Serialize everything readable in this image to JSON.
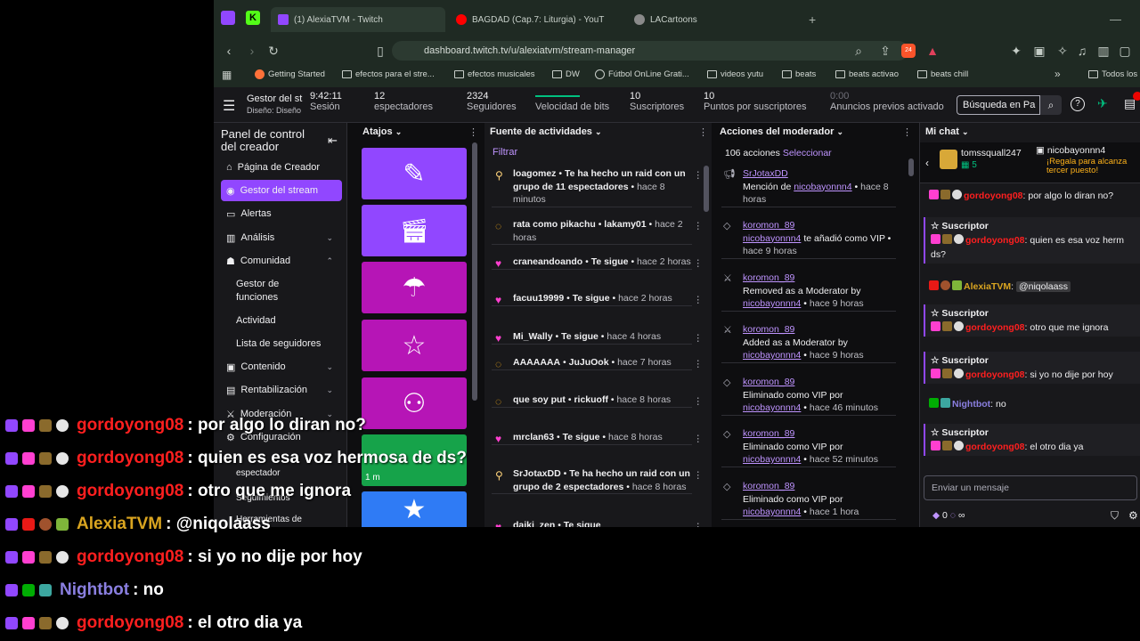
{
  "browser": {
    "tabs": [
      {
        "label": "(1) AlexiaTVM - Twitch",
        "color": "#9147ff"
      },
      {
        "label": "BAGDAD (Cap.7: Liturgia) - YouT",
        "color": "#ff0000"
      },
      {
        "label": "LACartoons",
        "color": "#8a8a8a"
      }
    ],
    "url": "dashboard.twitch.tv/u/alexiatvm/stream-manager",
    "bookmarks": [
      "Getting Started",
      "efectos para el stre...",
      "efectos musicales",
      "DW",
      "Fútbol OnLine Grati...",
      "videos yutu",
      "beats",
      "beats activao",
      "beats chill",
      "Todos los"
    ],
    "badge_count": "24"
  },
  "topbar": {
    "manager_title": "Gestor del st",
    "layout_label": "Diseño: Diseño",
    "session": {
      "value": "9:42:11",
      "label": "Sesión"
    },
    "viewers": {
      "value": "12",
      "label": "espectadores"
    },
    "followers": {
      "value": "2324",
      "label": "Seguidores"
    },
    "bitrate": {
      "label": "Velocidad de bits"
    },
    "subs": {
      "value": "10",
      "label": "Suscriptores"
    },
    "points": {
      "value": "10",
      "label": "Puntos por suscriptores"
    },
    "ads": {
      "value": "0:00",
      "label": "Anuncios previos activado"
    },
    "search_placeholder": "Búsqueda en Pa"
  },
  "sidebar": {
    "title": "Panel de control del creador",
    "items": [
      {
        "label": "Página de Creador",
        "icon": "home-icon"
      },
      {
        "label": "Gestor del stream",
        "icon": "broadcast-icon",
        "active": true
      },
      {
        "label": "Alertas",
        "icon": "alert-icon"
      },
      {
        "label": "Análisis",
        "icon": "chart-icon"
      },
      {
        "label": "Comunidad",
        "icon": "community-icon"
      }
    ],
    "sub_items": [
      "Gestor de funciones",
      "Actividad",
      "Lista de seguidores"
    ],
    "items2": [
      "Contenido",
      "Rentabilización",
      "Moderación",
      "Configuración"
    ],
    "hidden_items": [
      "espectador",
      "Seguimientos",
      "Herramientas de"
    ]
  },
  "atajos": {
    "title": "Atajos",
    "timer": "1 m"
  },
  "feed": {
    "title": "Fuente de actividades",
    "filter": "Filtrar",
    "items": [
      {
        "user": "loagomez",
        "action": "Te ha hecho un raid con un grupo de 11 espectadores",
        "time": "hace 8 minutos",
        "icon": "raid-icon"
      },
      {
        "user": "rata como pikachu",
        "action": "lakamy01",
        "time": "hace 2 horas",
        "icon": "points-icon"
      },
      {
        "user": "craneandoando",
        "action": "Te sigue",
        "time": "hace 2 horas",
        "icon": "heart-icon"
      },
      {
        "user": "facuu19999",
        "action": "Te sigue",
        "time": "hace 2 horas",
        "icon": "heart-icon"
      },
      {
        "user": "Mi_Wally",
        "action": "Te sigue",
        "time": "hace 4 horas",
        "icon": "heart-icon"
      },
      {
        "user": "AAAAAAA",
        "action": "JuJuOok",
        "time": "hace 7 horas",
        "icon": "points-icon"
      },
      {
        "user": "que soy put",
        "action": "rickuoff",
        "time": "hace 8 horas",
        "icon": "points-icon"
      },
      {
        "user": "mrclan63",
        "action": "Te sigue",
        "time": "hace 8 horas",
        "icon": "heart-icon"
      },
      {
        "user": "SrJotaxDD",
        "action": "Te ha hecho un raid con un grupo de 2 espectadores",
        "time": "hace 8 horas",
        "icon": "raid-icon"
      },
      {
        "user": "daiki_zen",
        "action": "Te sigue",
        "time": "",
        "icon": "heart-icon"
      }
    ]
  },
  "mod": {
    "title": "Acciones del moderador",
    "count": "106 acciones",
    "select": "Seleccionar",
    "items": [
      {
        "user": "SrJotaxDD",
        "text": "Mención de",
        "target": "nicobayonnn4",
        "time": "hace 8 horas"
      },
      {
        "user": "koromon_89",
        "text": "te añadió como VIP",
        "target": "nicobayonnn4",
        "time": "hace 9 horas"
      },
      {
        "user": "koromon_89",
        "text": "Removed as a Moderator by",
        "target": "nicobayonnn4",
        "time": "hace 9 horas"
      },
      {
        "user": "koromon_89",
        "text": "Added as a Moderator by",
        "target": "nicobayonnn4",
        "time": "hace 9 horas"
      },
      {
        "user": "koromon_89",
        "text": "Eliminado como VIP por",
        "target": "nicobayonnn4",
        "time": "hace 46 minutos"
      },
      {
        "user": "koromon_89",
        "text": "Eliminado como VIP por",
        "target": "nicobayonnn4",
        "time": "hace 52 minutos"
      },
      {
        "user": "koromon_89",
        "text": "Eliminado como VIP por",
        "target": "nicobayonnn4",
        "time": "hace 1 hora"
      }
    ]
  },
  "chat": {
    "title": "Mi chat",
    "gift_user1": "tomssquall247",
    "gift_count": "5",
    "gift_user2": "nicobayonnn4",
    "gift_msg": "¡Regala para alcanza tercer puesto!",
    "sub_label": "Suscriptor",
    "messages": [
      {
        "user": "gordoyong08",
        "text": ": por algo lo diran no?",
        "sub": false
      },
      {
        "user": "gordoyong08",
        "text": ": quien es esa voz herm ds?",
        "sub": true
      },
      {
        "user": "AlexiaTVM",
        "text": ":",
        "mention": "@niqolaass",
        "sub": false
      },
      {
        "user": "gordoyong08",
        "text": ": otro que me ignora",
        "sub": true
      },
      {
        "user": "gordoyong08",
        "text": ": si yo no dije por hoy",
        "sub": true
      },
      {
        "user": "Nightbot",
        "text": ": no",
        "sub": false
      },
      {
        "user": "gordoyong08",
        "text": ": el otro dia ya",
        "sub": true
      }
    ],
    "input_placeholder": "Enviar un mensaje",
    "points": "0",
    "points2": "∞"
  },
  "overlay": [
    {
      "user": "gordoyong08",
      "text": ": por algo lo diran no?",
      "color": "#ff1f1f"
    },
    {
      "user": "gordoyong08",
      "text": ": quien es esa voz hermosa de ds?",
      "color": "#ff1f1f"
    },
    {
      "user": "gordoyong08",
      "text": ": otro que me ignora",
      "color": "#ff1f1f"
    },
    {
      "user": "AlexiaTVM",
      "text": ": @niqolaass",
      "color": "#daa520"
    },
    {
      "user": "gordoyong08",
      "text": ": si yo no dije por hoy",
      "color": "#ff1f1f"
    },
    {
      "user": "Nightbot",
      "text": ": no",
      "color": "#8a7fe0"
    },
    {
      "user": "gordoyong08",
      "text": ": el otro dia ya",
      "color": "#ff1f1f"
    }
  ],
  "colors": {
    "twitch_purple": "#9147ff",
    "quick_magenta": "#b615b6",
    "quick_green": "#16a34a",
    "quick_blue": "#2f7bf5"
  }
}
